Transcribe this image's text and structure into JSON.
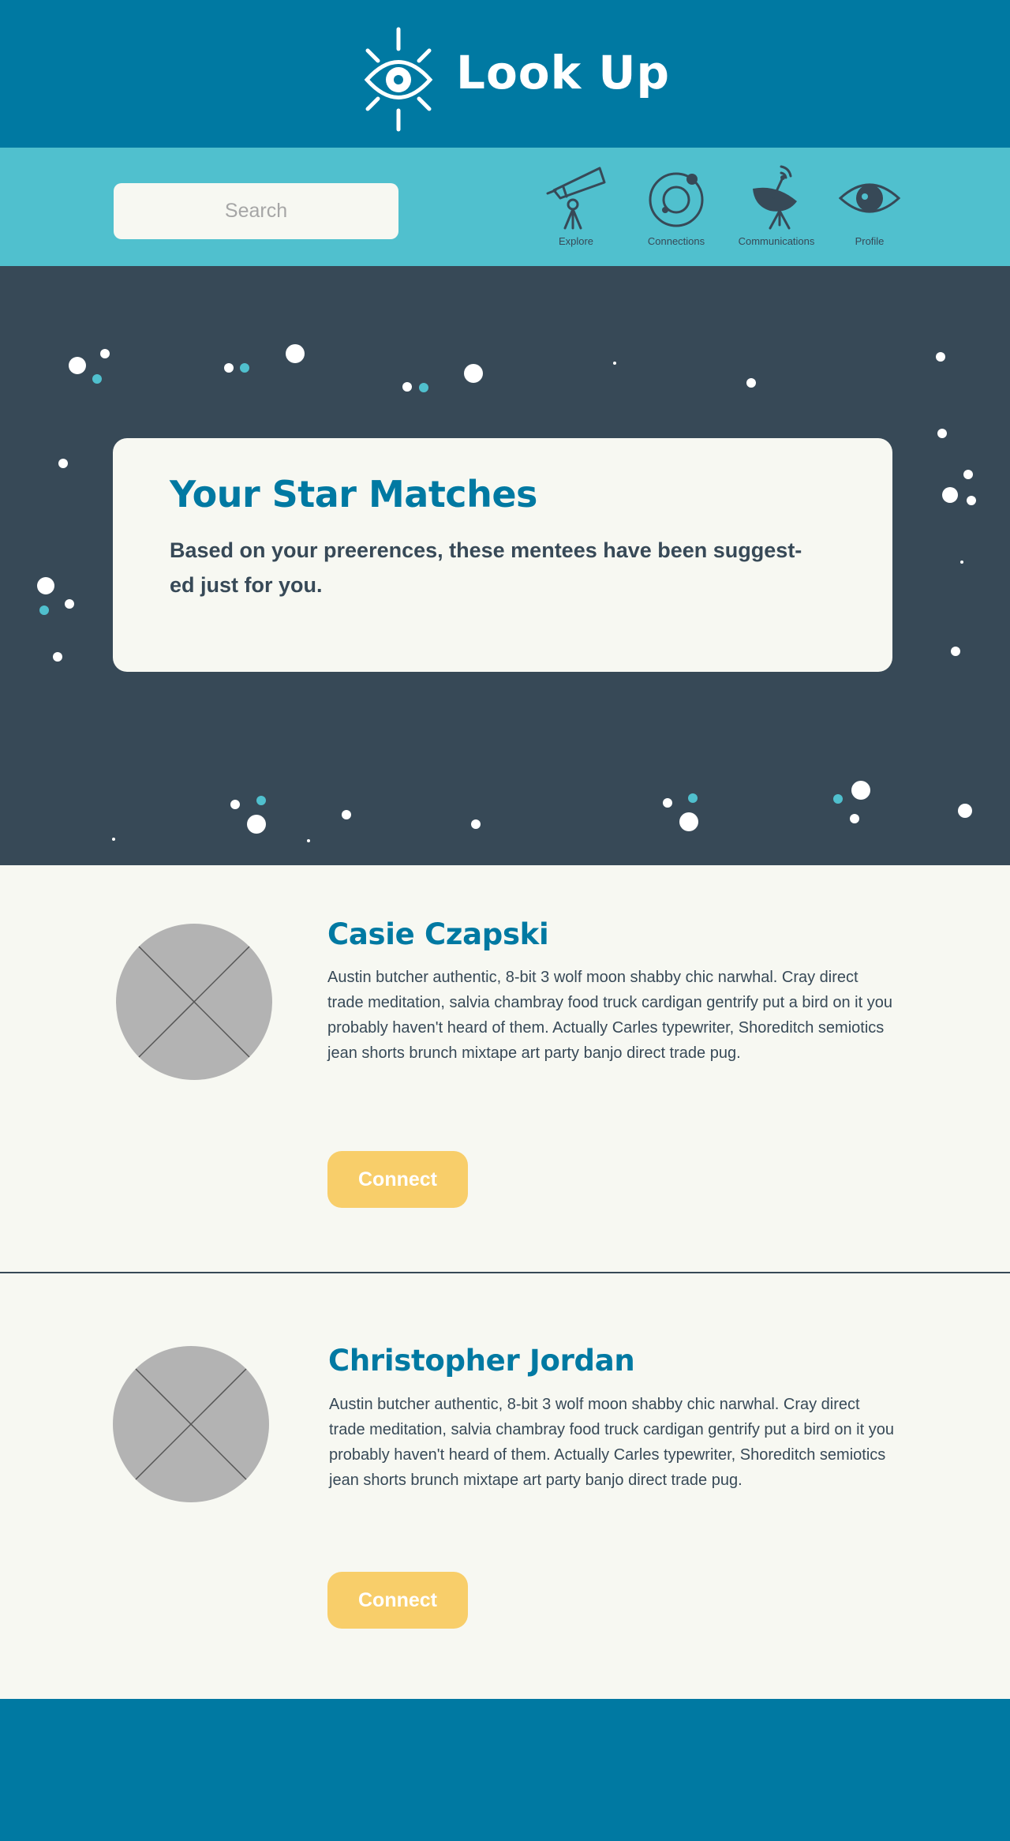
{
  "app": {
    "title": "Look Up",
    "logo_icon": "eye-sun-icon"
  },
  "nav": {
    "search_placeholder": "Search",
    "items": [
      {
        "label": "Explore",
        "icon": "telescope-icon"
      },
      {
        "label": "Connections",
        "icon": "orbit-icon"
      },
      {
        "label": "Communications",
        "icon": "satellite-dish-icon"
      },
      {
        "label": "Profile",
        "icon": "eye-icon"
      }
    ]
  },
  "hero": {
    "title": "Your Star Matches",
    "line1": "Based on your preerences, these mentees have been suggest-",
    "line2": "ed just for you."
  },
  "matches": [
    {
      "name": "Casie Czapski",
      "bio": "Austin butcher authentic, 8-bit 3 wolf moon shabby chic narwhal. Cray direct trade meditation, salvia chambray food truck cardigan gentrify put a bird on it you probably haven't heard of them. Actually Carles typewriter, Shoreditch semiotics jean shorts brunch mixtape art party banjo direct trade pug.",
      "button": "Connect"
    },
    {
      "name": "Christopher Jordan",
      "bio": "Austin butcher authentic, 8-bit 3 wolf moon shabby chic narwhal. Cray direct trade meditation, salvia chambray food truck cardigan gentrify put a bird on it you probably haven't heard of them. Actually Carles typewriter, Shoreditch semiotics jean shorts brunch mixtape art party banjo direct trade pug.",
      "button": "Connect"
    }
  ],
  "colors": {
    "brand_blue": "#0079a2",
    "nav_teal": "#50c0ce",
    "hero_slate": "#374957",
    "background": "#f7f8f2",
    "accent_yellow": "#f8ce6a",
    "placeholder_gray": "#b3b3b3"
  }
}
